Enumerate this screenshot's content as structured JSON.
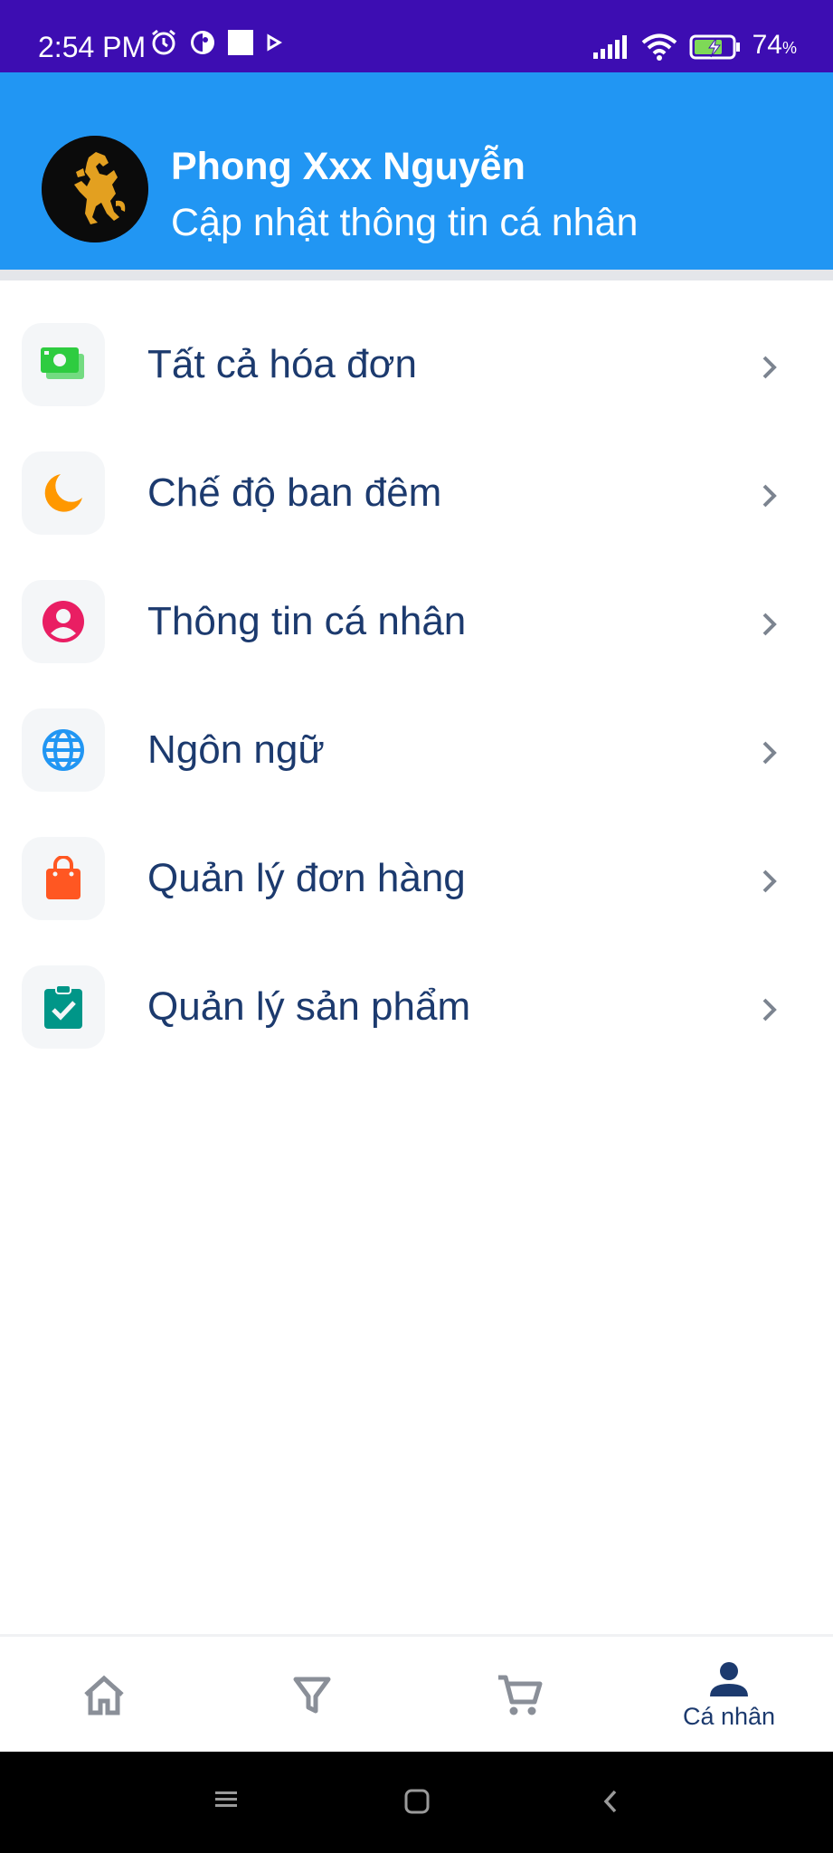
{
  "status_bar": {
    "time": "2:54 PM",
    "battery_percent": "74",
    "battery_unit": "%"
  },
  "profile": {
    "name": "Phong Xxx Nguyễn",
    "subtitle": "Cập nhật thông tin cá nhân"
  },
  "menu": {
    "items": [
      {
        "label": "Tất cả hóa đơn",
        "icon": "bills-icon",
        "color": "#2ecc40"
      },
      {
        "label": "Chế độ ban đêm",
        "icon": "moon-icon",
        "color": "#ff9800"
      },
      {
        "label": "Thông tin cá nhân",
        "icon": "account-circle-icon",
        "color": "#e91e63"
      },
      {
        "label": "Ngôn ngữ",
        "icon": "globe-icon",
        "color": "#2196f3"
      },
      {
        "label": "Quản lý đơn hàng",
        "icon": "shopping-bag-icon",
        "color": "#ff5722"
      },
      {
        "label": "Quản lý sản phẩm",
        "icon": "clipboard-check-icon",
        "color": "#009688"
      }
    ]
  },
  "bottom_nav": {
    "items": [
      {
        "icon": "home-icon",
        "label": ""
      },
      {
        "icon": "filter-icon",
        "label": ""
      },
      {
        "icon": "cart-icon",
        "label": ""
      },
      {
        "icon": "person-icon",
        "label": "Cá nhân",
        "active": true
      }
    ]
  },
  "colors": {
    "status_bar": "#3d0db2",
    "header": "#2196f3",
    "text_primary": "#1c3a6e",
    "nav_inactive": "#8a8f98",
    "nav_active": "#1c3a6e"
  }
}
